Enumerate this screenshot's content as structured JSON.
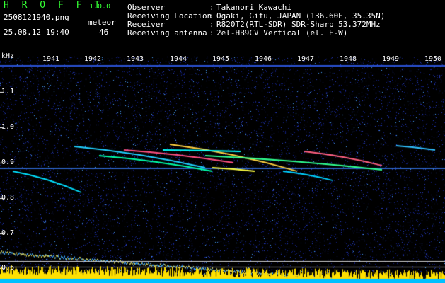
{
  "app": {
    "name": "H R O F F T",
    "version": "1.0.0"
  },
  "file": {
    "name": "2508121940.png",
    "timestamp": "25.08.12 19:40"
  },
  "meteor": {
    "label": "meteor",
    "count": "46"
  },
  "info": [
    {
      "key": "Observer",
      "value": "Takanori Kawachi"
    },
    {
      "key": "Receiving Location",
      "value": "Ogaki, Gifu, JAPAN (136.60E, 35.35N)"
    },
    {
      "key": "Receiver",
      "value": "R820T2(RTL-SDR) SDR-Sharp 53.372MHz"
    },
    {
      "key": "Receiving antenna",
      "value": "2el-HB9CV Vertical (el. E-W)"
    }
  ],
  "axis": {
    "unit": "kHz",
    "x_ticks": [
      "1941",
      "1942",
      "1943",
      "1944",
      "1945",
      "1946",
      "1947",
      "1948",
      "1949",
      "1950"
    ],
    "y_ticks": [
      "1.1",
      "1.0",
      "0.9",
      "0.8",
      "0.7",
      "0.6"
    ]
  },
  "colors": {
    "title": "#33ff33",
    "background": "#000000",
    "noise": "#1a2a9a",
    "signal": "#00ffff"
  }
}
